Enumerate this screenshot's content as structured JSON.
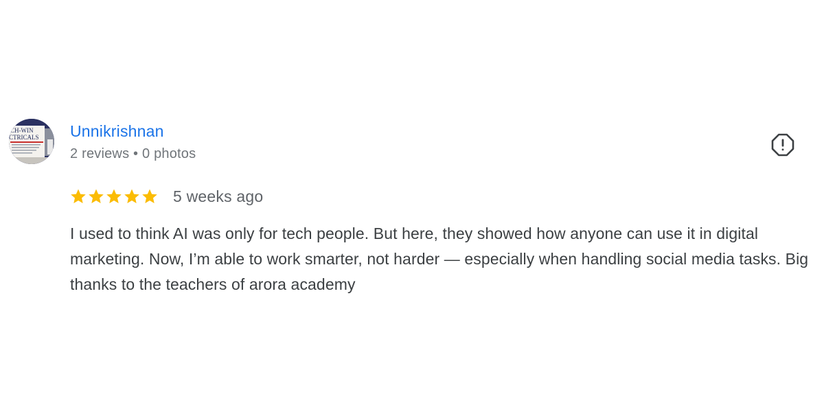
{
  "reviewer": {
    "name": "Unnikrishnan",
    "meta": "2 reviews • 0 photos",
    "avatar_text_line1": "CH-WIN",
    "avatar_text_line2": "CTRICALS"
  },
  "review": {
    "rating": 5,
    "rating_max": 5,
    "date": "5 weeks ago",
    "text": "I used to think AI was only for tech people. But here, they showed how anyone can use it in digital marketing. Now, I’m able to work smarter, not harder — especially when handling social media tasks. Big thanks to the teachers of arora academy"
  },
  "icons": {
    "report": "report-flag-icon",
    "star": "star-icon"
  },
  "colors": {
    "name_link": "#1a73e8",
    "star": "#fbbc04",
    "meta_text": "#70757a",
    "body_text": "#3c4043",
    "icon": "#3c4043"
  }
}
